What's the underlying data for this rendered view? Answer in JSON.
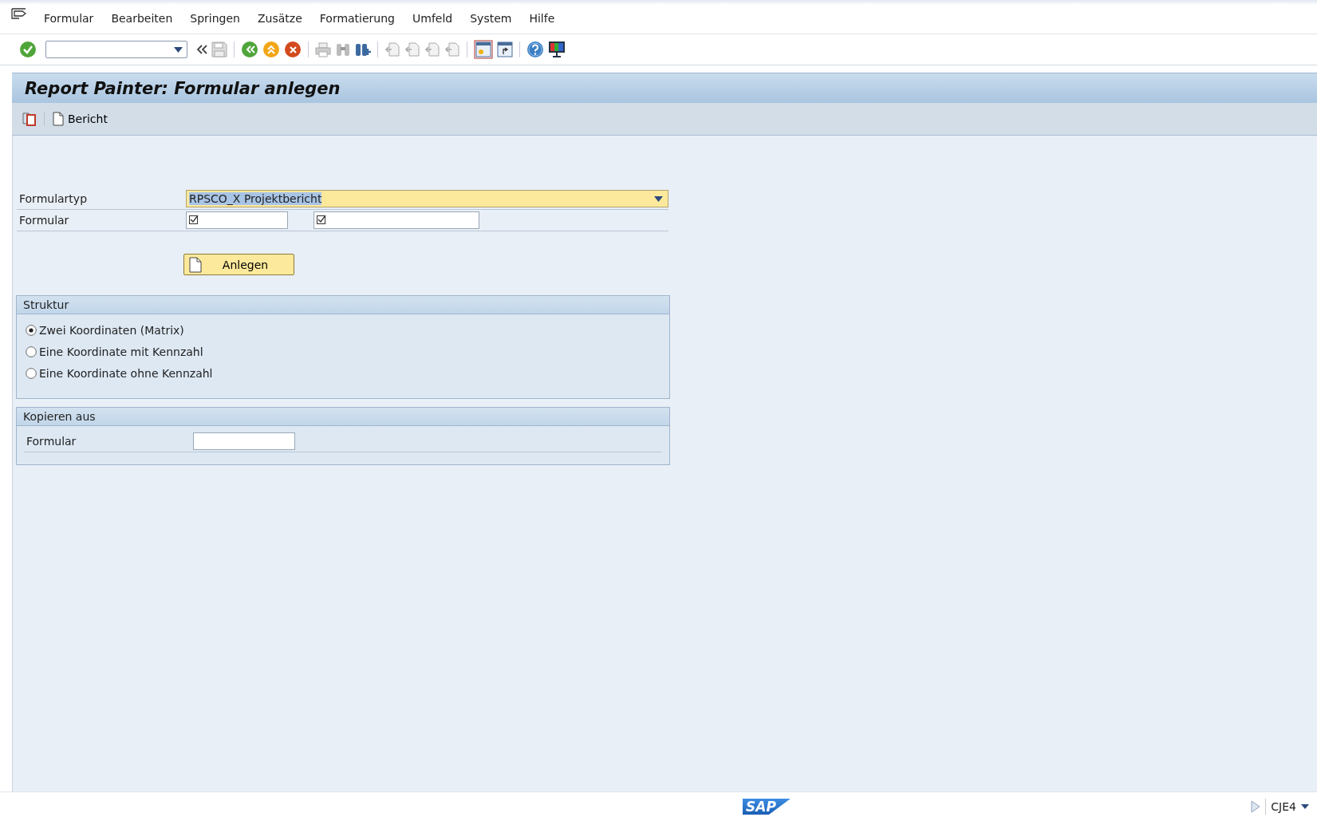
{
  "menu_bar": {
    "items": [
      "Formular",
      "Bearbeiten",
      "Springen",
      "Zusätze",
      "Formatierung",
      "Umfeld",
      "System",
      "Hilfe"
    ]
  },
  "title": "Report Painter: Formular anlegen",
  "app_toolbar": {
    "buttons": [
      "Bericht"
    ]
  },
  "form": {
    "fields": [
      {
        "kind": "dropdown",
        "label": "Formulartyp",
        "value": "RPSCO_X Projektbericht",
        "text_selected": true
      },
      {
        "kind": "range",
        "label": "Formular",
        "required": true
      }
    ],
    "create_button": "Anlegen"
  },
  "groups": [
    {
      "kind": "radios",
      "title": "Struktur",
      "options": [
        {
          "label": "Zwei Koordinaten (Matrix)",
          "selected": true
        },
        {
          "label": "Eine Koordinate mit Kennzahl",
          "selected": false
        },
        {
          "label": "Eine Koordinate ohne Kennzahl",
          "selected": false
        }
      ]
    },
    {
      "kind": "fields",
      "title": "Kopieren aus",
      "fields": [
        {
          "label": "Formular"
        }
      ]
    }
  ],
  "status_bar": {
    "logo": "SAP",
    "transaction": "CJE4"
  }
}
